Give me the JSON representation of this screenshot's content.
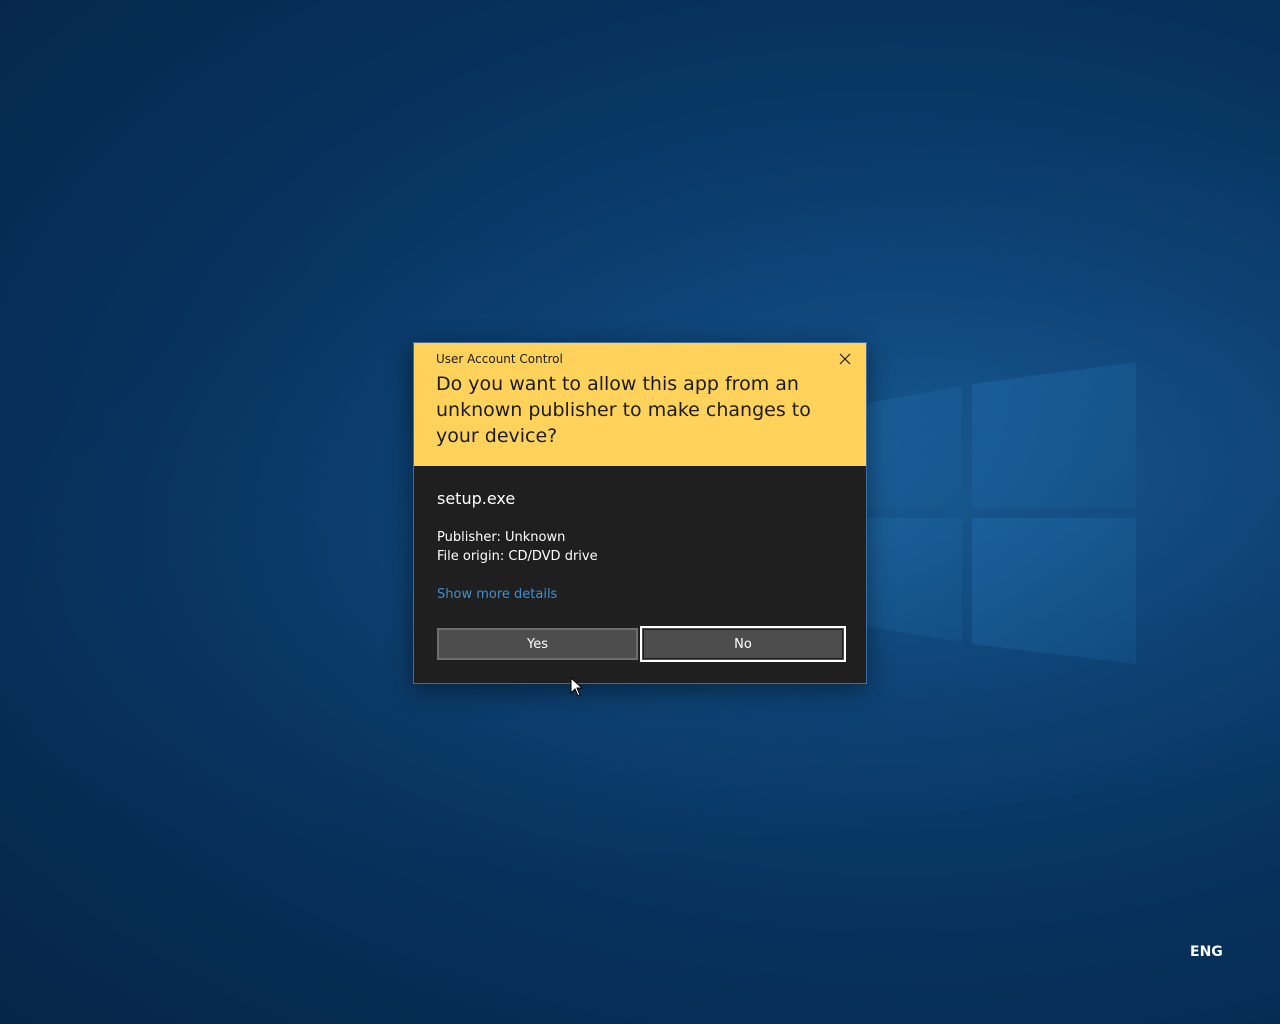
{
  "dialog": {
    "title": "User Account Control",
    "question": "Do you want to allow this app from an unknown publisher to make changes to your device?",
    "app_name": "setup.exe",
    "publisher": "Publisher: Unknown",
    "file_origin": "File origin: CD/DVD drive",
    "details_link": "Show more details",
    "yes_label": "Yes",
    "no_label": "No",
    "close_icon": "close-icon"
  },
  "system_tray": {
    "language": "ENG"
  },
  "colors": {
    "header_background": "#ffd35b",
    "body_background": "#1f1f1f",
    "link": "#3d8fd6",
    "button": "#4d4d4d",
    "desktop": "#07315c"
  }
}
